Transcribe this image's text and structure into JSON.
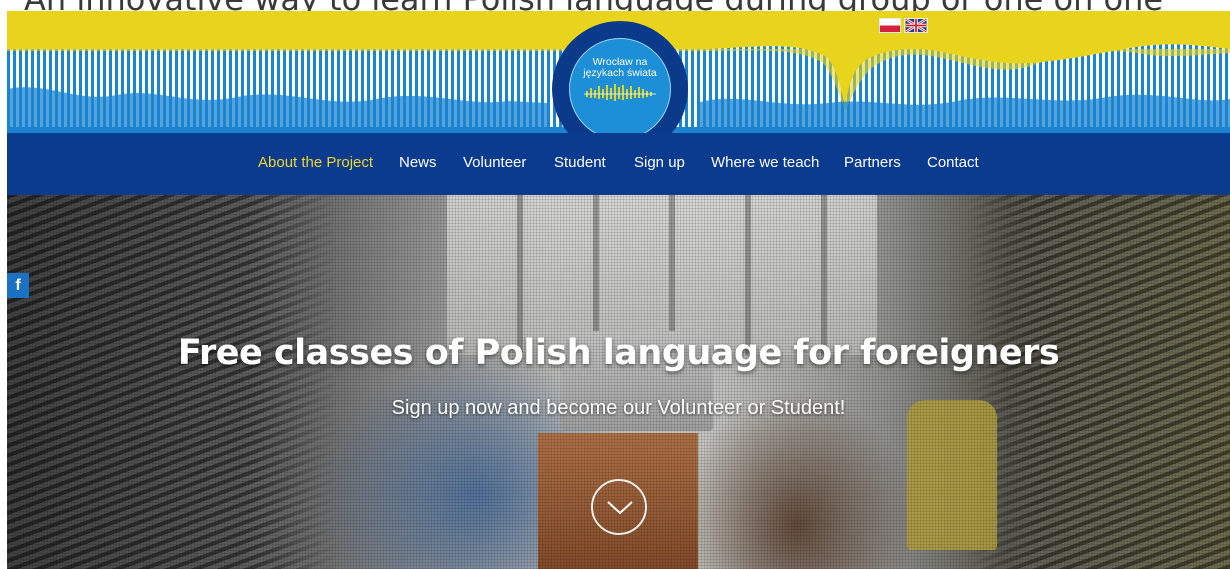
{
  "tagline": "An innovative way to learn Polish language during group or one on one",
  "logo": {
    "text": "Wrocław na językach świata"
  },
  "languages": [
    {
      "code": "pl",
      "icon": "poland-flag-icon"
    },
    {
      "code": "en",
      "icon": "uk-flag-icon"
    }
  ],
  "nav": {
    "items": [
      {
        "label": "About the Project",
        "active": true
      },
      {
        "label": "News"
      },
      {
        "label": "Volunteer"
      },
      {
        "label": "Student"
      },
      {
        "label": "Sign up"
      },
      {
        "label": "Where we teach"
      },
      {
        "label": "Partners"
      },
      {
        "label": "Contact"
      }
    ]
  },
  "hero": {
    "title": "Free classes of Polish language for foreigners",
    "subtitle": "Sign up now and become our Volunteer or Student!",
    "scroll_icon": "chevron-down-icon"
  },
  "social": {
    "facebook_glyph": "f",
    "icon": "facebook-icon"
  },
  "colors": {
    "header_yellow": "#e8d41c",
    "nav_blue": "#0a3b8f",
    "stripe_blue": "#1c8fd6",
    "active_nav": "#f0d62a"
  }
}
